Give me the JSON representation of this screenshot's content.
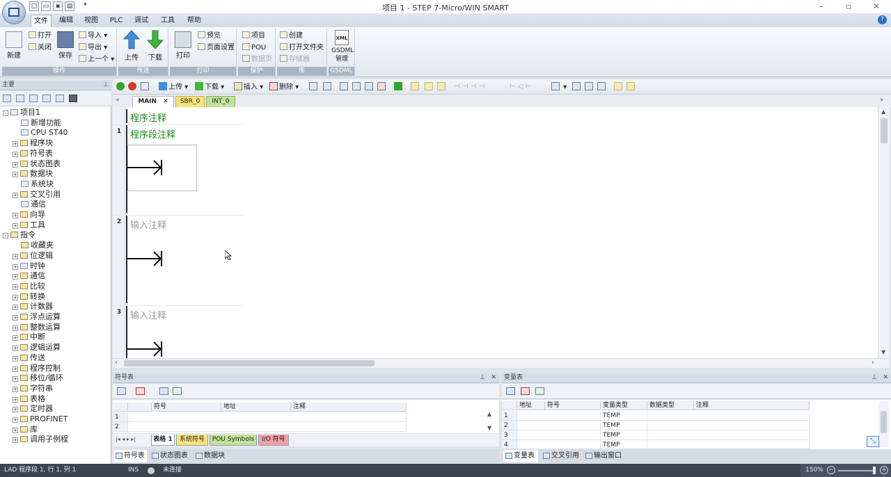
{
  "app": {
    "title": "项目 1 - STEP 7-Micro/WIN SMART",
    "help_label": "?"
  },
  "menu_tabs": [
    "文件",
    "编辑",
    "视图",
    "PLC",
    "调试",
    "工具",
    "帮助"
  ],
  "ribbon": {
    "groups": [
      {
        "label": "操作",
        "big": [
          {
            "label": "新建"
          },
          {
            "label": "保存"
          }
        ],
        "small": [
          "打开",
          "关闭",
          "导入",
          "导出",
          "上一个"
        ]
      },
      {
        "label": "传送",
        "big": [
          {
            "label": "上传"
          },
          {
            "label": "下载"
          }
        ]
      },
      {
        "label": "打印",
        "big": [
          {
            "label": "打印"
          }
        ],
        "small": [
          "预览",
          "页面设置"
        ]
      },
      {
        "label": "保护",
        "small": [
          "项目",
          "POU",
          "数据页"
        ]
      },
      {
        "label": "库",
        "small": [
          "创建",
          "打开文件夹",
          "存储器"
        ]
      },
      {
        "label": "GSDML",
        "big": [
          {
            "label": "GSDML 管理"
          }
        ],
        "xml_badge": "XML"
      }
    ]
  },
  "left_pane": {
    "title": "主要",
    "tree": [
      {
        "label": "项目1",
        "level": 0,
        "expander": "-",
        "icon": "project-icon"
      },
      {
        "label": "新增功能",
        "level": 1,
        "icon": "new-features-icon"
      },
      {
        "label": "CPU ST40",
        "level": 1,
        "icon": "cpu-icon"
      },
      {
        "label": "程序块",
        "level": 1,
        "expander": "+",
        "icon": "folder-icon"
      },
      {
        "label": "符号表",
        "level": 1,
        "expander": "+",
        "icon": "folder-icon"
      },
      {
        "label": "状态图表",
        "level": 1,
        "expander": "+",
        "icon": "folder-icon"
      },
      {
        "label": "数据块",
        "level": 1,
        "expander": "+",
        "icon": "folder-icon"
      },
      {
        "label": "系统块",
        "level": 1,
        "icon": "system-block-icon"
      },
      {
        "label": "交叉引用",
        "level": 1,
        "expander": "+",
        "icon": "folder-icon"
      },
      {
        "label": "通信",
        "level": 1,
        "icon": "communication-icon"
      },
      {
        "label": "向导",
        "level": 1,
        "expander": "+",
        "icon": "folder-icon"
      },
      {
        "label": "工具",
        "level": 1,
        "expander": "+",
        "icon": "folder-icon"
      },
      {
        "label": "指令",
        "level": 0,
        "expander": "-",
        "icon": "folder-icon"
      },
      {
        "label": "收藏夹",
        "level": 1,
        "icon": "folder-icon"
      },
      {
        "label": "位逻辑",
        "level": 1,
        "expander": "+",
        "icon": "folder-icon"
      },
      {
        "label": "时钟",
        "level": 1,
        "expander": "+",
        "icon": "clock-icon"
      },
      {
        "label": "通信",
        "level": 1,
        "expander": "+",
        "icon": "folder-icon"
      },
      {
        "label": "比较",
        "level": 1,
        "expander": "+",
        "icon": "folder-icon"
      },
      {
        "label": "转换",
        "level": 1,
        "expander": "+",
        "icon": "folder-icon"
      },
      {
        "label": "计数器",
        "level": 1,
        "expander": "+",
        "icon": "folder-icon"
      },
      {
        "label": "浮点运算",
        "level": 1,
        "expander": "+",
        "icon": "folder-icon"
      },
      {
        "label": "整数运算",
        "level": 1,
        "expander": "+",
        "icon": "folder-icon"
      },
      {
        "label": "中断",
        "level": 1,
        "expander": "+",
        "icon": "folder-icon"
      },
      {
        "label": "逻辑运算",
        "level": 1,
        "expander": "+",
        "icon": "folder-icon"
      },
      {
        "label": "传送",
        "level": 1,
        "expander": "+",
        "icon": "folder-icon"
      },
      {
        "label": "程序控制",
        "level": 1,
        "expander": "+",
        "icon": "folder-icon"
      },
      {
        "label": "移位/循环",
        "level": 1,
        "expander": "+",
        "icon": "folder-icon"
      },
      {
        "label": "字符串",
        "level": 1,
        "expander": "+",
        "icon": "folder-icon"
      },
      {
        "label": "表格",
        "level": 1,
        "expander": "+",
        "icon": "folder-icon"
      },
      {
        "label": "定时器",
        "level": 1,
        "expander": "+",
        "icon": "folder-icon"
      },
      {
        "label": "PROFINET",
        "level": 1,
        "expander": "+",
        "icon": "folder-icon"
      },
      {
        "label": "库",
        "level": 1,
        "expander": "+",
        "icon": "folder-icon"
      },
      {
        "label": "调用子例程",
        "level": 1,
        "expander": "+",
        "icon": "folder-icon"
      }
    ]
  },
  "editor_toolbar": {
    "upload": "上传",
    "download": "下载",
    "insert": "插入",
    "delete": "删除"
  },
  "program_tabs": [
    {
      "label": "MAIN",
      "active": true,
      "color": "#ffffff"
    },
    {
      "label": "SBR_0",
      "active": false,
      "color": "#f7e37a"
    },
    {
      "label": "INT_0",
      "active": false,
      "color": "#bfe39a"
    }
  ],
  "ladder": {
    "program_comment": "程序注释",
    "networks": [
      {
        "number": "1",
        "comment": "程序段注释",
        "placeholder": false
      },
      {
        "number": "2",
        "comment": "输入注释",
        "placeholder": true
      },
      {
        "number": "3",
        "comment": "输入注释",
        "placeholder": true
      }
    ]
  },
  "symbol_panel": {
    "title": "符号表",
    "columns": [
      "符号",
      "地址",
      "注释"
    ],
    "rows": [
      "1",
      "2"
    ],
    "sheet_tabs": [
      {
        "label": "表格 1",
        "color": "#ffffff"
      },
      {
        "label": "系统符号",
        "color": "#f7e37a"
      },
      {
        "label": "POU Symbols",
        "color": "#bfe39a"
      },
      {
        "label": "I/O 符号",
        "color": "#f0a0a8"
      }
    ],
    "bottom_tabs": [
      "符号表",
      "状态图表",
      "数据块"
    ]
  },
  "variable_panel": {
    "title": "变量表",
    "columns": [
      "地址",
      "符号",
      "变量类型",
      "数据类型",
      "注释"
    ],
    "rows": [
      {
        "n": "1",
        "type": "TEMP"
      },
      {
        "n": "2",
        "type": "TEMP"
      },
      {
        "n": "3",
        "type": "TEMP"
      },
      {
        "n": "4",
        "type": "TEMP"
      }
    ],
    "bottom_tabs": [
      "变量表",
      "交叉引用",
      "输出窗口"
    ]
  },
  "status": {
    "position": "LAD 程序段 1, 行 1, 列 1",
    "mode": "INS",
    "connection": "未连接",
    "zoom": "150%"
  },
  "colors": {
    "accent": "#2d6fc2",
    "comment_green": "#1a8a1a",
    "statusbar": "#3c4450"
  }
}
